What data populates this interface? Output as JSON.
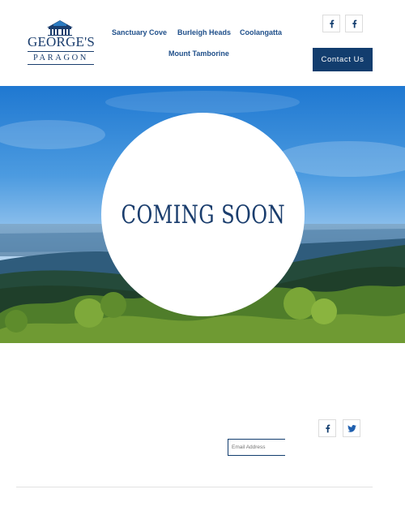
{
  "logo": {
    "title": "GEORGE'S",
    "subtitle": "PARAGON"
  },
  "nav": {
    "items": [
      {
        "label": "Sanctuary Cove"
      },
      {
        "label": "Burleigh Heads"
      },
      {
        "label": "Coolangatta"
      },
      {
        "label": "Mount Tamborine"
      }
    ]
  },
  "header": {
    "social": [
      "facebook-icon",
      "facebook-icon"
    ],
    "contact_label": "Contact Us"
  },
  "hero": {
    "heading": "COMING SOON"
  },
  "footer": {
    "email_placeholder": "Email Address",
    "social": [
      "facebook-icon",
      "twitter-icon"
    ]
  },
  "colors": {
    "brand": "#123d6e",
    "nav_text": "#1f4f8a",
    "background": "#ffffff"
  }
}
